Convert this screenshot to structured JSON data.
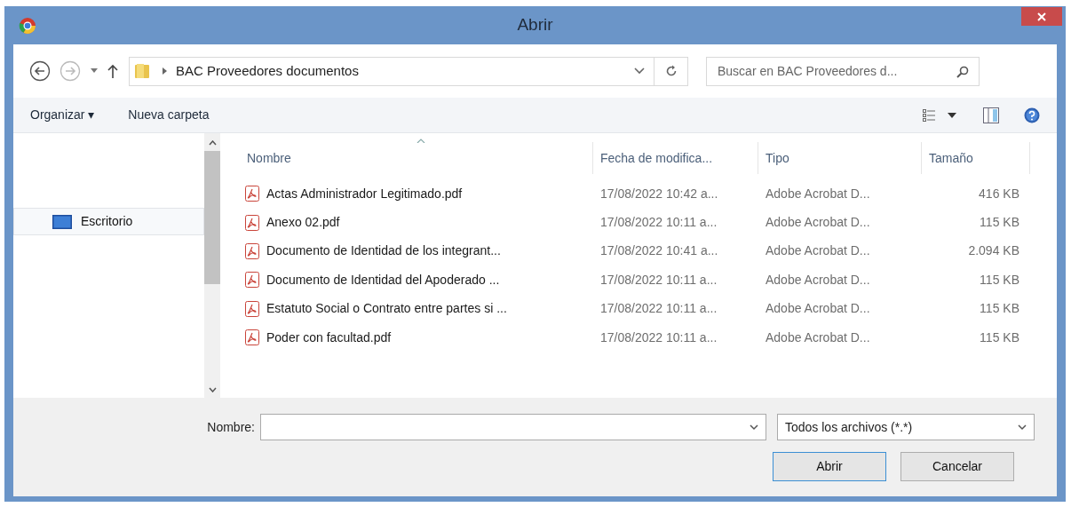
{
  "window": {
    "title": "Abrir"
  },
  "address": {
    "path": "BAC Proveedores documentos",
    "search_placeholder": "Buscar en BAC Proveedores d..."
  },
  "toolbar": {
    "organize": "Organizar ▾",
    "new_folder": "Nueva carpeta"
  },
  "nav": {
    "items": [
      {
        "label": "Escritorio",
        "selected": true
      }
    ]
  },
  "table": {
    "columns": [
      "Nombre",
      "Fecha de modifica...",
      "Tipo",
      "Tamaño"
    ],
    "rows": [
      {
        "name": "Actas Administrador Legitimado.pdf",
        "date": "17/08/2022 10:42 a...",
        "type": "Adobe Acrobat D...",
        "size": "416 KB"
      },
      {
        "name": "Anexo 02.pdf",
        "date": "17/08/2022 10:11 a...",
        "type": "Adobe Acrobat D...",
        "size": "115 KB"
      },
      {
        "name": "Documento de Identidad de los integrant...",
        "date": "17/08/2022 10:41 a...",
        "type": "Adobe Acrobat D...",
        "size": "2.094 KB"
      },
      {
        "name": "Documento de Identidad del Apoderado ...",
        "date": "17/08/2022 10:11 a...",
        "type": "Adobe Acrobat D...",
        "size": "115 KB"
      },
      {
        "name": "Estatuto Social o Contrato entre partes si ...",
        "date": "17/08/2022 10:11 a...",
        "type": "Adobe Acrobat D...",
        "size": "115 KB"
      },
      {
        "name": "Poder con facultad.pdf",
        "date": "17/08/2022 10:11 a...",
        "type": "Adobe Acrobat D...",
        "size": "115 KB"
      }
    ]
  },
  "footer": {
    "filename_label": "Nombre:",
    "filter": "Todos los archivos (*.*)",
    "buttons": [
      "Abrir",
      "Cancelar"
    ]
  }
}
